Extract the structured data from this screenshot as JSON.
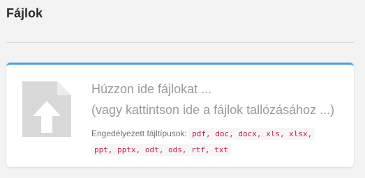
{
  "page": {
    "title": "Fájlok"
  },
  "dropzone": {
    "heading": "Húzzon ide fájlokat ...",
    "subheading": "(vagy kattintson ide a fájlok tallózásához ...)",
    "allowed_label": "Engedélyezett fájltípusok:",
    "allowed_types_line1": "pdf, doc, docx, xls, xlsx,",
    "allowed_types_line2": "ppt, pptx, odt, ods, rtf, txt",
    "icon": "file-upload-icon",
    "accent_color": "#4a9fe0"
  }
}
